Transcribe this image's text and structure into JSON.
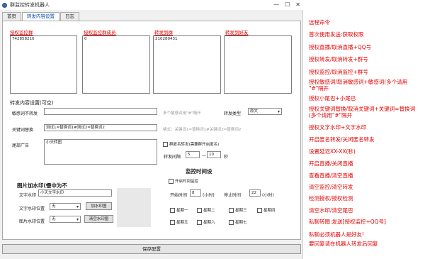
{
  "window": {
    "title": "群监控转发机器人",
    "controls": [
      "—",
      "☐",
      "✕"
    ]
  },
  "tabs": [
    {
      "label": "首页"
    },
    {
      "label": "转发内容设置"
    },
    {
      "label": "日志"
    }
  ],
  "lists": {
    "authorized_groups": {
      "label": "授权监控群",
      "items": [
        "742858210"
      ]
    },
    "authorized_members": {
      "label": "授权监控群成员",
      "items": [
        "0"
      ]
    },
    "forward_to_groups": {
      "label": "转发到群",
      "items": [
        "210280431"
      ]
    },
    "forward_to_friends": {
      "label": "转发到好友",
      "items": []
    }
  },
  "settings": {
    "title": "转发内容设置(可空)",
    "sensitive_words_label": "敏感词不转发",
    "sensitive_words_value": "",
    "sensitive_words_hint": "多个敏感词用\"#\"隔开",
    "forward_type_label": "转发类型",
    "forward_type_value": "原文",
    "keyword_replace_label": "关键词替换",
    "keyword_replace_value": "测试1=替换词1#测试2=替换词2",
    "keyword_replace_hint": "格式：关键词1=替换词1#关键词2=替换词2",
    "ad_label": "尾部广告",
    "ad_value": "小天转图",
    "anonymous_label": "群匿名转发(需要群开启匿名)",
    "interval_label": "转发间隔",
    "interval_min": "5",
    "interval_sep": "—",
    "interval_max": "10",
    "interval_unit": "秒"
  },
  "watermark": {
    "title": "图片加水印(慢中为不",
    "text_label": "文字水印",
    "text_value": "小天文字水印",
    "text_pos_label": "文字水印位置",
    "text_pos_value": "无",
    "add_btn": "加水印图",
    "img_pos_label": "图片水印位置",
    "img_pos_value": "无",
    "clear_btn": "清空水印图"
  },
  "schedule": {
    "title": "监控时间设",
    "enable_label": "开启时间监控",
    "start_label": "开始时间",
    "start_value": "8",
    "start_unit": "(小时)",
    "stop_label": "停止时间",
    "stop_value": "22",
    "stop_unit": "(小时)",
    "days": [
      "星期一",
      "星期二",
      "星期三",
      "星期四",
      "星期五",
      "星期六",
      "星期七"
    ]
  },
  "save_button": "保存配置",
  "commands": [
    "远程命令",
    "首次使用发送:获取权限",
    "授权直播/取消直播+QQ号",
    "授权转发/取消转发+群号",
    "授权监控/取消监控+群号",
    "授权敏感词/取消敏感词+敏感词(多个请用",
    "\"#\"隔开",
    "授权小尾巴+小尾巴",
    "授权关键词替换/取消关键词+关键词=替换词",
    "(多个请用\"#\"隔开",
    "授权文字水印+文字水印",
    "开启匿名转发/关闭匿名转发",
    "设置延迟XX-XX(秒)",
    "开启直播/关闭直播",
    "查看直播/清空直播",
    "清空监控/清空转发",
    "检测授权/授权检测",
    "清空水印/清空尾巴",
    "私聊转图:发送[授权监控+QQ号]",
    "私聊必须机器人是好友!",
    "要回复请在机器人转发后回复"
  ]
}
